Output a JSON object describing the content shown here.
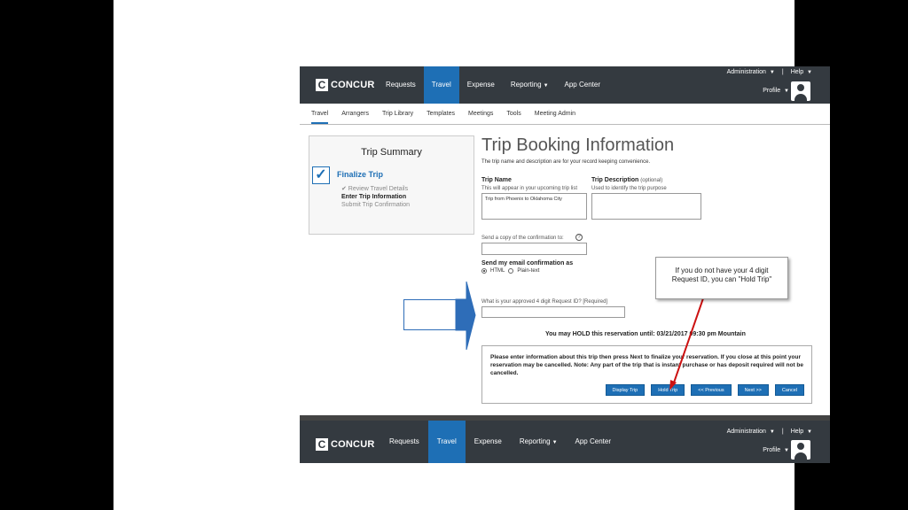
{
  "app": {
    "logo_mark": "C",
    "logo_text": "CONCUR"
  },
  "topnav": {
    "items": [
      {
        "label": "Requests"
      },
      {
        "label": "Travel"
      },
      {
        "label": "Expense"
      },
      {
        "label": "Reporting"
      },
      {
        "label": "App Center"
      }
    ],
    "admin": "Administration",
    "separator": "|",
    "help": "Help",
    "profile": "Profile",
    "active_color": "#1e6fb5",
    "bar_color": "#343a40"
  },
  "subnav": {
    "items": [
      "Travel",
      "Arrangers",
      "Trip Library",
      "Templates",
      "Meetings",
      "Tools",
      "Meeting Admin"
    ]
  },
  "summary": {
    "title": "Trip Summary",
    "finalize": "Finalize Trip",
    "step_done": "✔ Review Travel Details",
    "step_current": "Enter Trip Information",
    "step_next": "Submit Trip Confirmation"
  },
  "form": {
    "page_title": "Trip Booking Information",
    "intro": "The trip name and description are for your record keeping convenience.",
    "trip_name_label": "Trip Name",
    "trip_name_hint": "This will appear in your upcoming trip list",
    "trip_name_value": "Trip from Phoenix to Oklahoma City",
    "trip_desc_label": "Trip Description",
    "trip_desc_optional": "(optional)",
    "trip_desc_hint": "Used to identify the trip purpose",
    "copy_label": "Send a copy of the confirmation to:",
    "email_label": "Send my email confirmation as",
    "radio_html": "HTML",
    "radio_plain": "Plain-text",
    "request_id_label": "What is your approved 4 digit Request ID? [Required]",
    "hold_until": "You may HOLD this reservation until: 03/21/2017 09:30 pm Mountain",
    "message": "Please enter information about this trip then press Next to finalize your reservation. If you close at this point your reservation may be cancelled. Note: Any part of the trip that is instant purchase or has deposit required will not be cancelled.",
    "buttons": {
      "display_trip": "Display Trip",
      "hold_trip": "Hold Trip",
      "previous": "<< Previous",
      "next": "Next >>",
      "cancel": "Cancel"
    }
  },
  "callout": {
    "text": "If you do not have your 4 digit Request ID, you can \"Hold Trip\""
  },
  "colors": {
    "arrow": "#2e6db8",
    "pointer": "#cc1111"
  }
}
